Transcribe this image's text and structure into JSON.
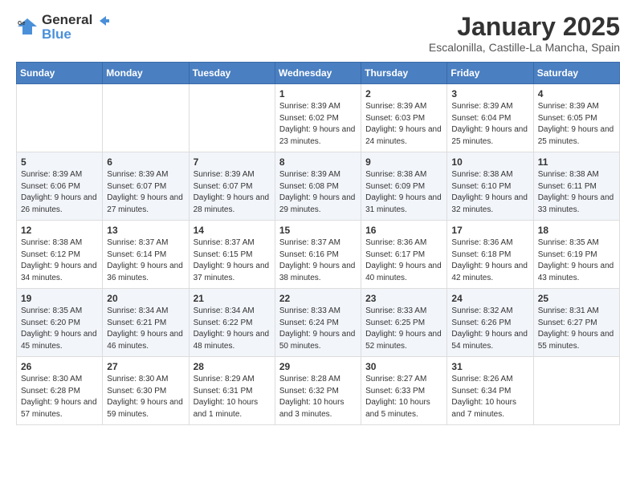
{
  "header": {
    "logo_line1": "General",
    "logo_line2": "Blue",
    "month": "January 2025",
    "location": "Escalonilla, Castille-La Mancha, Spain"
  },
  "weekdays": [
    "Sunday",
    "Monday",
    "Tuesday",
    "Wednesday",
    "Thursday",
    "Friday",
    "Saturday"
  ],
  "weeks": [
    [
      {
        "day": "",
        "info": ""
      },
      {
        "day": "",
        "info": ""
      },
      {
        "day": "",
        "info": ""
      },
      {
        "day": "1",
        "info": "Sunrise: 8:39 AM\nSunset: 6:02 PM\nDaylight: 9 hours and 23 minutes."
      },
      {
        "day": "2",
        "info": "Sunrise: 8:39 AM\nSunset: 6:03 PM\nDaylight: 9 hours and 24 minutes."
      },
      {
        "day": "3",
        "info": "Sunrise: 8:39 AM\nSunset: 6:04 PM\nDaylight: 9 hours and 25 minutes."
      },
      {
        "day": "4",
        "info": "Sunrise: 8:39 AM\nSunset: 6:05 PM\nDaylight: 9 hours and 25 minutes."
      }
    ],
    [
      {
        "day": "5",
        "info": "Sunrise: 8:39 AM\nSunset: 6:06 PM\nDaylight: 9 hours and 26 minutes."
      },
      {
        "day": "6",
        "info": "Sunrise: 8:39 AM\nSunset: 6:07 PM\nDaylight: 9 hours and 27 minutes."
      },
      {
        "day": "7",
        "info": "Sunrise: 8:39 AM\nSunset: 6:07 PM\nDaylight: 9 hours and 28 minutes."
      },
      {
        "day": "8",
        "info": "Sunrise: 8:39 AM\nSunset: 6:08 PM\nDaylight: 9 hours and 29 minutes."
      },
      {
        "day": "9",
        "info": "Sunrise: 8:38 AM\nSunset: 6:09 PM\nDaylight: 9 hours and 31 minutes."
      },
      {
        "day": "10",
        "info": "Sunrise: 8:38 AM\nSunset: 6:10 PM\nDaylight: 9 hours and 32 minutes."
      },
      {
        "day": "11",
        "info": "Sunrise: 8:38 AM\nSunset: 6:11 PM\nDaylight: 9 hours and 33 minutes."
      }
    ],
    [
      {
        "day": "12",
        "info": "Sunrise: 8:38 AM\nSunset: 6:12 PM\nDaylight: 9 hours and 34 minutes."
      },
      {
        "day": "13",
        "info": "Sunrise: 8:37 AM\nSunset: 6:14 PM\nDaylight: 9 hours and 36 minutes."
      },
      {
        "day": "14",
        "info": "Sunrise: 8:37 AM\nSunset: 6:15 PM\nDaylight: 9 hours and 37 minutes."
      },
      {
        "day": "15",
        "info": "Sunrise: 8:37 AM\nSunset: 6:16 PM\nDaylight: 9 hours and 38 minutes."
      },
      {
        "day": "16",
        "info": "Sunrise: 8:36 AM\nSunset: 6:17 PM\nDaylight: 9 hours and 40 minutes."
      },
      {
        "day": "17",
        "info": "Sunrise: 8:36 AM\nSunset: 6:18 PM\nDaylight: 9 hours and 42 minutes."
      },
      {
        "day": "18",
        "info": "Sunrise: 8:35 AM\nSunset: 6:19 PM\nDaylight: 9 hours and 43 minutes."
      }
    ],
    [
      {
        "day": "19",
        "info": "Sunrise: 8:35 AM\nSunset: 6:20 PM\nDaylight: 9 hours and 45 minutes."
      },
      {
        "day": "20",
        "info": "Sunrise: 8:34 AM\nSunset: 6:21 PM\nDaylight: 9 hours and 46 minutes."
      },
      {
        "day": "21",
        "info": "Sunrise: 8:34 AM\nSunset: 6:22 PM\nDaylight: 9 hours and 48 minutes."
      },
      {
        "day": "22",
        "info": "Sunrise: 8:33 AM\nSunset: 6:24 PM\nDaylight: 9 hours and 50 minutes."
      },
      {
        "day": "23",
        "info": "Sunrise: 8:33 AM\nSunset: 6:25 PM\nDaylight: 9 hours and 52 minutes."
      },
      {
        "day": "24",
        "info": "Sunrise: 8:32 AM\nSunset: 6:26 PM\nDaylight: 9 hours and 54 minutes."
      },
      {
        "day": "25",
        "info": "Sunrise: 8:31 AM\nSunset: 6:27 PM\nDaylight: 9 hours and 55 minutes."
      }
    ],
    [
      {
        "day": "26",
        "info": "Sunrise: 8:30 AM\nSunset: 6:28 PM\nDaylight: 9 hours and 57 minutes."
      },
      {
        "day": "27",
        "info": "Sunrise: 8:30 AM\nSunset: 6:30 PM\nDaylight: 9 hours and 59 minutes."
      },
      {
        "day": "28",
        "info": "Sunrise: 8:29 AM\nSunset: 6:31 PM\nDaylight: 10 hours and 1 minute."
      },
      {
        "day": "29",
        "info": "Sunrise: 8:28 AM\nSunset: 6:32 PM\nDaylight: 10 hours and 3 minutes."
      },
      {
        "day": "30",
        "info": "Sunrise: 8:27 AM\nSunset: 6:33 PM\nDaylight: 10 hours and 5 minutes."
      },
      {
        "day": "31",
        "info": "Sunrise: 8:26 AM\nSunset: 6:34 PM\nDaylight: 10 hours and 7 minutes."
      },
      {
        "day": "",
        "info": ""
      }
    ]
  ]
}
